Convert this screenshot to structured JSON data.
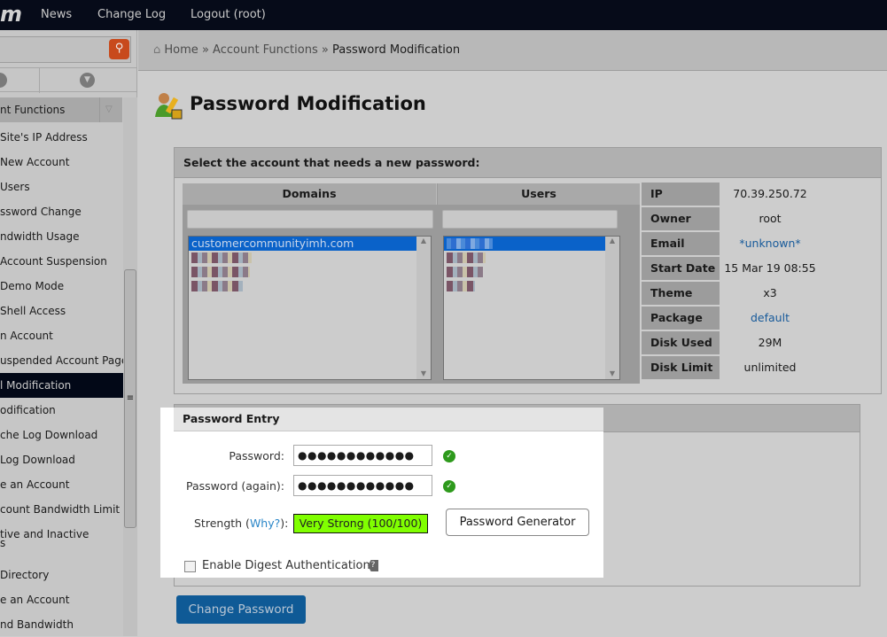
{
  "topnav": {
    "logo": "m",
    "items": [
      "News",
      "Change Log",
      "Logout (root)"
    ]
  },
  "sidebar": {
    "category": "nt Functions",
    "items": [
      "Site's IP Address",
      "New Account",
      "Users",
      "ssword Change",
      "ndwidth Usage",
      "Account Suspension",
      "Demo Mode",
      "Shell Access",
      "n Account",
      "uspended Account Page",
      "l Modification",
      "odification",
      "che Log Download",
      "Log Download",
      "e an Account",
      "count Bandwidth Limit",
      "tive and Inactive",
      "s",
      "Directory",
      "e an Account",
      "nd Bandwidth"
    ],
    "selected": "l Modification"
  },
  "breadcrumb": {
    "home": "Home",
    "sep": "»",
    "section": "Account Functions",
    "current": "Password Modification"
  },
  "page_title": "Password Modification",
  "select_panel": {
    "title": "Select the account that needs a new password:",
    "domains_header": "Domains",
    "users_header": "Users",
    "domains": [
      "customercommunityimh.com"
    ]
  },
  "info": [
    {
      "label": "IP",
      "value": "70.39.250.72"
    },
    {
      "label": "Owner",
      "value": "root"
    },
    {
      "label": "Email",
      "value": "*unknown*",
      "link": true
    },
    {
      "label": "Start Date",
      "value": "15 Mar 19 08:55"
    },
    {
      "label": "Theme",
      "value": "x3"
    },
    {
      "label": "Package",
      "value": "default",
      "link": true
    },
    {
      "label": "Disk Used",
      "value": "29M"
    },
    {
      "label": "Disk Limit",
      "value": "unlimited"
    }
  ],
  "password_entry": {
    "title": "Password Entry",
    "password_label": "Password:",
    "password_value": "●●●●●●●●●●●●",
    "again_label": "Password (again):",
    "again_value": "●●●●●●●●●●●●",
    "strength_label": "Strength",
    "why": "Why?",
    "strength_value": "Very Strong (100/100)",
    "strength_score": 100,
    "generator": "Password Generator",
    "digest_label": "Enable Digest Authentication",
    "digest_checked": false
  },
  "change_button": "Change Password",
  "colors": {
    "accent": "#0f5a96",
    "strength": "#80ff00",
    "selected": "#0a62c9"
  }
}
